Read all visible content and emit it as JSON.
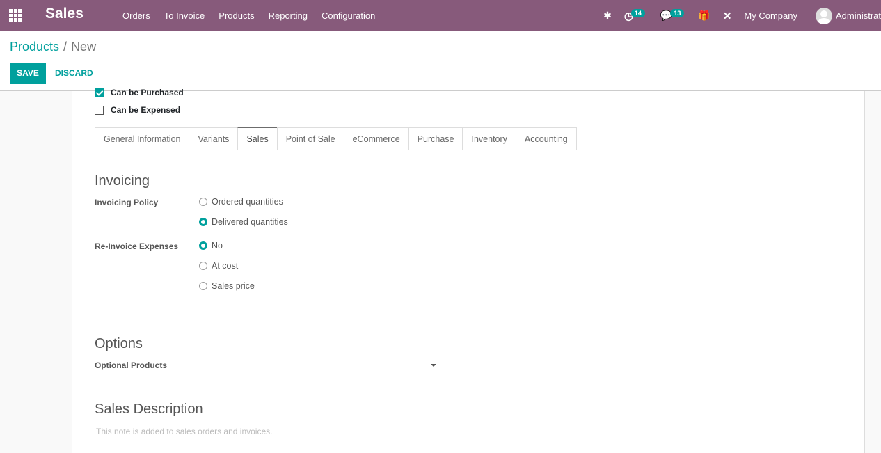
{
  "navbar": {
    "app_name": "Sales",
    "menu": [
      "Orders",
      "To Invoice",
      "Products",
      "Reporting",
      "Configuration"
    ],
    "activity_count": "14",
    "message_count": "13",
    "company": "My Company",
    "user": "Administrat"
  },
  "breadcrumb": {
    "parent": "Products",
    "separator": "/",
    "current": "New"
  },
  "buttons": {
    "save": "SAVE",
    "discard": "DISCARD"
  },
  "checkboxes": [
    {
      "label": "Can be Purchased",
      "checked": true
    },
    {
      "label": "Can be Expensed",
      "checked": false
    }
  ],
  "tabs": [
    "General Information",
    "Variants",
    "Sales",
    "Point of Sale",
    "eCommerce",
    "Purchase",
    "Inventory",
    "Accounting"
  ],
  "active_tab": "Sales",
  "invoicing": {
    "title": "Invoicing",
    "policy_label": "Invoicing Policy",
    "policy_options": [
      "Ordered quantities",
      "Delivered quantities"
    ],
    "policy_selected": "Delivered quantities",
    "reinvoice_label": "Re-Invoice Expenses",
    "reinvoice_options": [
      "No",
      "At cost",
      "Sales price"
    ],
    "reinvoice_selected": "No"
  },
  "options": {
    "title": "Options",
    "optional_products_label": "Optional Products",
    "optional_products_value": ""
  },
  "sales_description": {
    "title": "Sales Description",
    "placeholder": "This note is added to sales orders and invoices."
  }
}
